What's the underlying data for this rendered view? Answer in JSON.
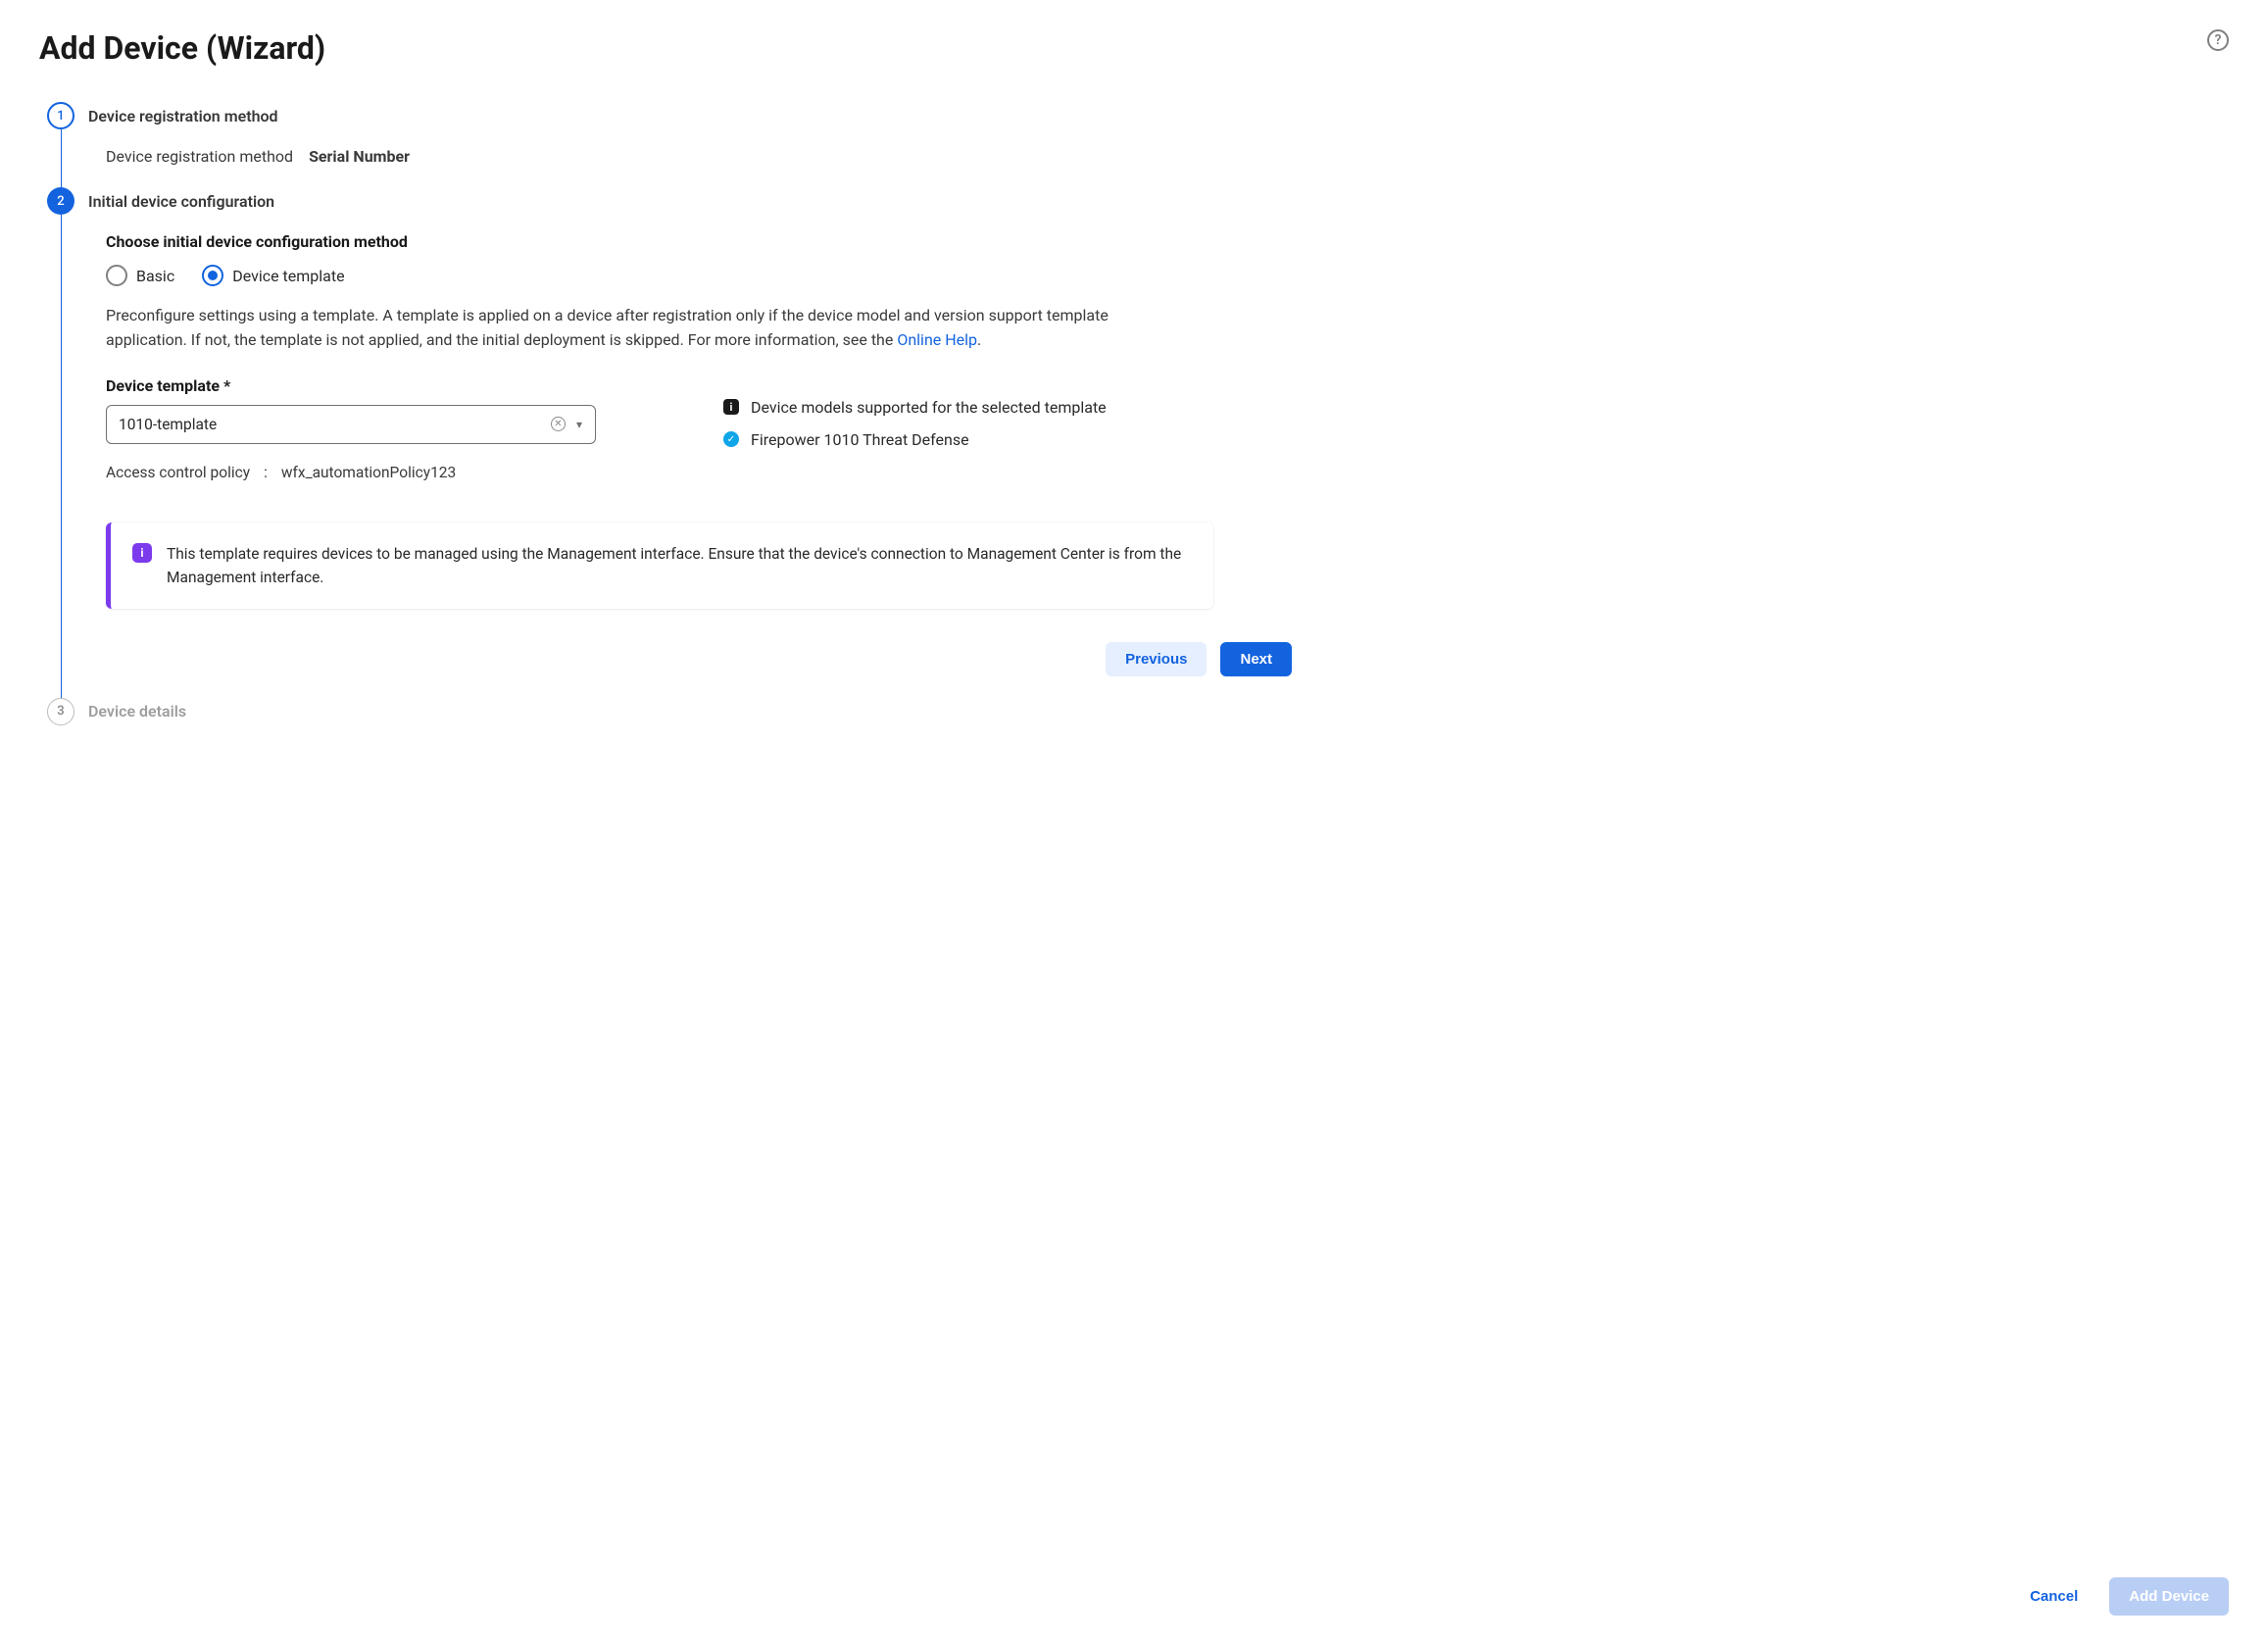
{
  "page": {
    "title": "Add Device (Wizard)"
  },
  "steps": {
    "s1": {
      "num": "1",
      "label": "Device registration method",
      "summary_key": "Device registration method",
      "summary_value": "Serial Number"
    },
    "s2": {
      "num": "2",
      "label": "Initial device configuration",
      "heading": "Choose initial device configuration method",
      "radios": {
        "basic": "Basic",
        "template": "Device template"
      },
      "desc_pre": "Preconfigure settings using a template. A template is applied on a device after registration only if the device model and version support template application. If not, the template is not applied, and the initial deployment is skipped. For more information, see the ",
      "desc_link": "Online Help",
      "desc_post": ".",
      "template_field_label": "Device template *",
      "template_value": "1010-template",
      "acp_key": "Access control policy",
      "acp_sep": ":",
      "acp_value": "wfx_automationPolicy123",
      "support_heading": "Device models supported for the selected template",
      "support_item": "Firepower 1010 Threat Defense",
      "callout": "This template requires devices to be managed using the Management interface. Ensure that the device's connection to Management Center is from the Management interface.",
      "btn_prev": "Previous",
      "btn_next": "Next"
    },
    "s3": {
      "num": "3",
      "label": "Device details"
    }
  },
  "footer": {
    "cancel": "Cancel",
    "add": "Add Device"
  }
}
